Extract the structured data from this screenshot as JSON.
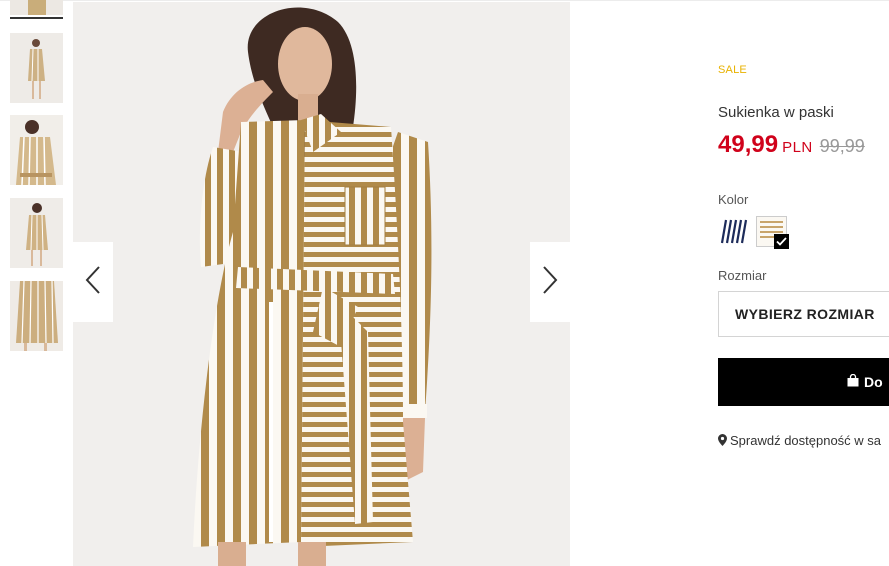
{
  "thumbnails": [
    {
      "name": "thumbnail-1",
      "active": true
    },
    {
      "name": "thumbnail-2"
    },
    {
      "name": "thumbnail-3"
    },
    {
      "name": "thumbnail-4"
    },
    {
      "name": "thumbnail-5"
    }
  ],
  "gallery": {
    "prev_icon": "chevron-left-icon",
    "next_icon": "chevron-right-icon"
  },
  "product": {
    "badge": "SALE",
    "title": "Sukienka w paski",
    "price_new": "49,99",
    "currency": "PLN",
    "price_old": "99,99",
    "color_label": "Kolor",
    "colors": [
      {
        "name": "navy-stripes",
        "selected": false
      },
      {
        "name": "beige-stripes",
        "selected": true
      }
    ],
    "size_label": "Rozmiar",
    "size_placeholder": "WYBIERZ ROZMIAR",
    "add_to_cart_label": "Do",
    "store_check_label": "Sprawdź dostępność w sa"
  },
  "colors": {
    "sale": "#e8b200",
    "price": "#d0021b",
    "old_price": "#999999",
    "button": "#000000"
  }
}
